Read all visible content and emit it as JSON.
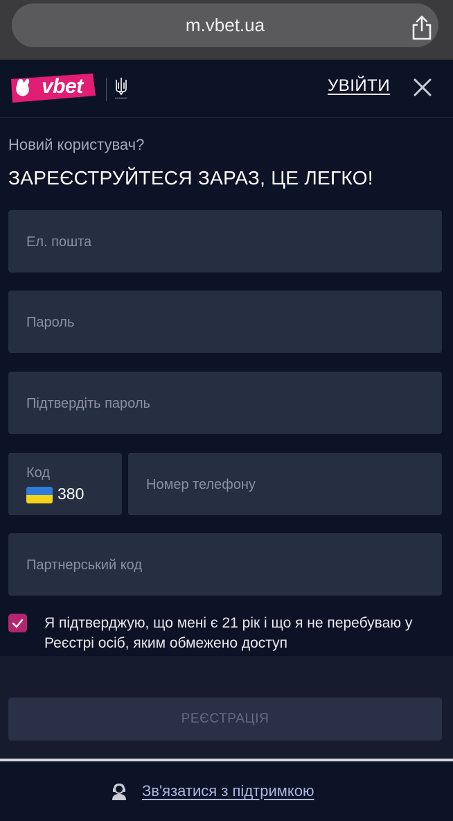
{
  "browser": {
    "url": "m.vbet.ua"
  },
  "header": {
    "logo_text": "vbet",
    "emblem_caption": "UKRAINE",
    "login_label": "УВІЙТИ"
  },
  "intro": {
    "subtitle": "Новий користувач?",
    "heading": "ЗАРЕЄСТРУЙТЕСЯ ЗАРАЗ, ЦЕ ЛЕГКО!"
  },
  "form": {
    "email_placeholder": "Ел. пошта",
    "password_placeholder": "Пароль",
    "confirm_placeholder": "Підтвердіть пароль",
    "code_label": "Код",
    "code_value": "380",
    "phone_placeholder": "Номер телефону",
    "partner_placeholder": "Партнерський код",
    "terms_checked": true,
    "terms_text": "Я підтверджую, що мені є 21 рік і що я не перебуваю у Реєстрі осіб, яким обмежено доступ"
  },
  "actions": {
    "register_label": "РЕЄСТРАЦІЯ",
    "support_label": "Зв'язатися з підтримкою"
  },
  "colors": {
    "background": "#0d1326",
    "field": "#262e42",
    "accent": "#b3266f",
    "logo_pink": "#e11d74",
    "flag_blue": "#2f7bd9",
    "flag_yellow": "#f5d31a"
  },
  "icons": [
    "share-icon",
    "close-icon",
    "checkmark-icon",
    "support-agent-icon",
    "trident-icon"
  ]
}
